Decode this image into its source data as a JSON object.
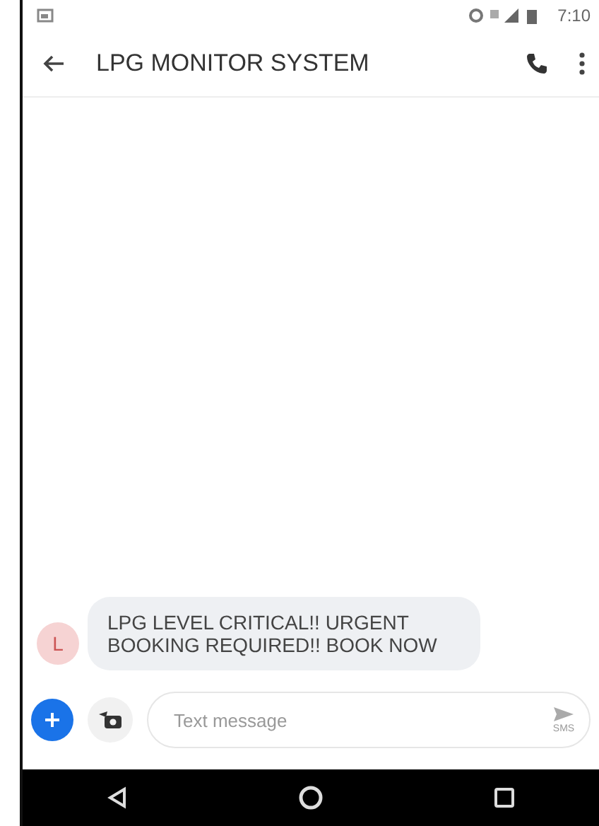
{
  "status_bar": {
    "time": "7:10"
  },
  "app_bar": {
    "title": "LPG MONITOR SYSTEM"
  },
  "messages": [
    {
      "avatar_letter": "L",
      "text": "LPG LEVEL CRITICAL!! URGENT BOOKING REQUIRED!! BOOK NOW"
    }
  ],
  "composer": {
    "placeholder": "Text message",
    "send_label": "SMS"
  }
}
